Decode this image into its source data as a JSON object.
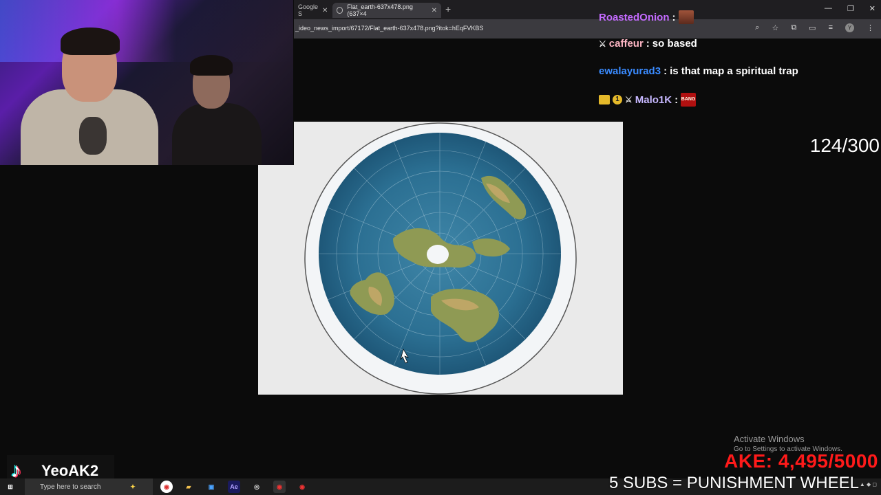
{
  "browser": {
    "inactive_tab": "Google S",
    "active_tab": "Flat_earth-637x478.png (637×4",
    "url": "_ideo_news_import/67172/Flat_earth-637x478.png?itok=hEqFVKBS"
  },
  "chat": [
    {
      "user": "RoastedOnion",
      "text": "",
      "color": "#c46bff"
    },
    {
      "user": "caffeur",
      "text": "so based",
      "color": "#ffb7c5"
    },
    {
      "user": "ewalayurad3",
      "text": "is that map a spiritual trap",
      "color": "#3a8bff"
    },
    {
      "user": "Malo1K",
      "text": "",
      "color": "#c7b8ff"
    }
  ],
  "overlay": {
    "counter": "124/300",
    "goal": "AKE: 4,495/5000",
    "wheel": "5 SUBS = PUNISHMENT WHEEL",
    "tiktok_name": "YeoAK2",
    "activate_title": "Activate Windows",
    "activate_sub": "Go to Settings to activate Windows."
  },
  "taskbar": {
    "search_placeholder": "Type here to search"
  }
}
